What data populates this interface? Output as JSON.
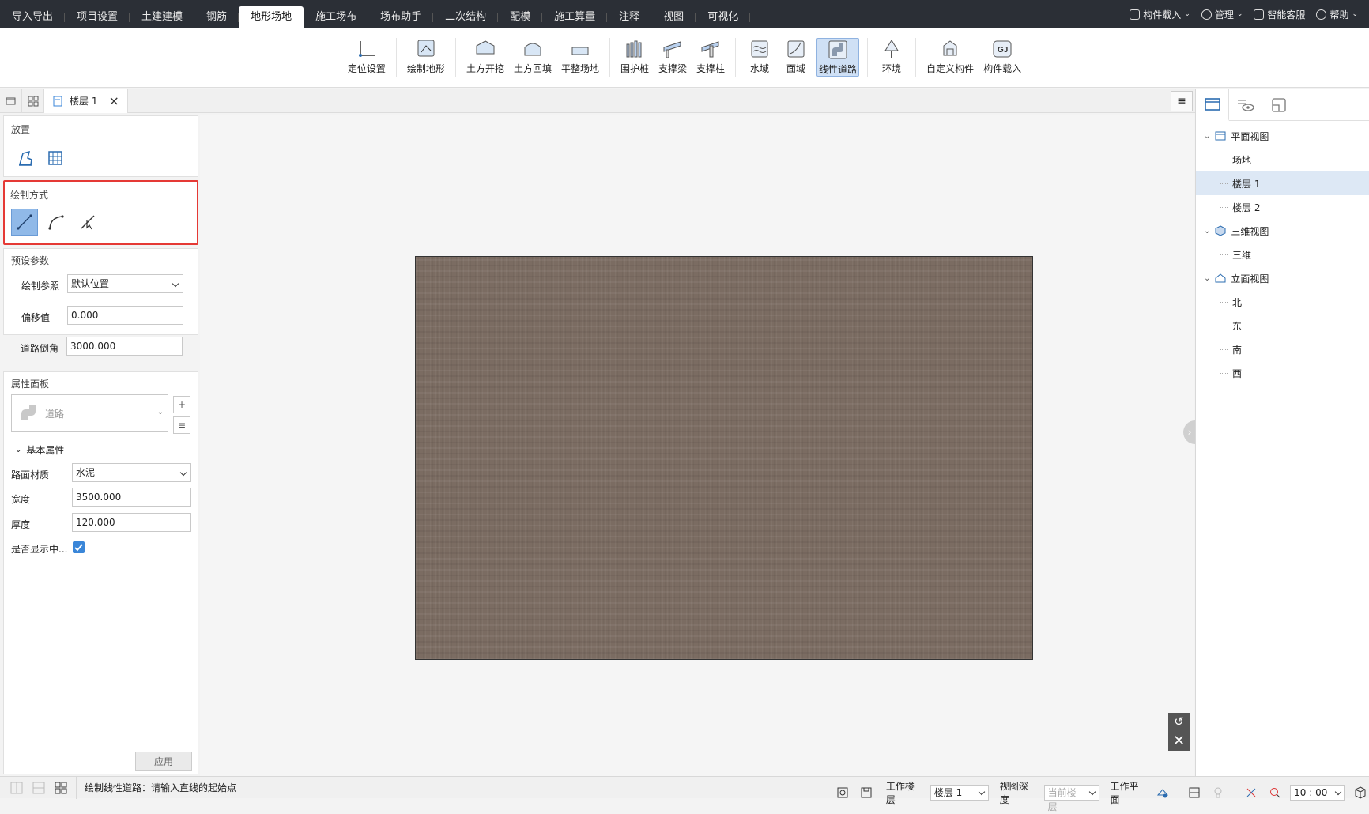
{
  "menubar": {
    "tabs": [
      "导入导出",
      "项目设置",
      "土建建模",
      "钢筋",
      "地形场地",
      "施工场布",
      "场布助手",
      "二次结构",
      "配模",
      "施工算量",
      "注释",
      "视图",
      "可视化"
    ],
    "active_tab": "地形场地",
    "right": {
      "load": "构件载入",
      "manage": "管理",
      "service": "智能客服",
      "help": "帮助"
    }
  },
  "ribbon": {
    "groups": [
      [
        {
          "label": "定位设置",
          "icon": "axis-icon"
        }
      ],
      [
        {
          "label": "绘制地形",
          "icon": "terrain-icon"
        }
      ],
      [
        {
          "label": "土方开挖",
          "icon": "excavate-icon"
        },
        {
          "label": "土方回填",
          "icon": "backfill-icon"
        },
        {
          "label": "平整场地",
          "icon": "level-icon"
        }
      ],
      [
        {
          "label": "围护桩",
          "icon": "pile-icon"
        },
        {
          "label": "支撑梁",
          "icon": "beam-icon"
        },
        {
          "label": "支撑柱",
          "icon": "column-icon"
        }
      ],
      [
        {
          "label": "水域",
          "icon": "water-icon"
        },
        {
          "label": "面域",
          "icon": "area-icon"
        },
        {
          "label": "线性道路",
          "icon": "road-icon",
          "active": true
        }
      ],
      [
        {
          "label": "环境",
          "icon": "tree-icon"
        }
      ],
      [
        {
          "label": "自定义构件",
          "icon": "custom-icon"
        },
        {
          "label": "构件载入",
          "icon": "gj-icon"
        }
      ]
    ]
  },
  "viewtabs": {
    "floor_tab": "楼层 1"
  },
  "leftpanel": {
    "place_title": "放置",
    "draw_title": "绘制方式",
    "preset_title": "预设参数",
    "preset": {
      "ref_label": "绘制参照",
      "ref_value": "默认位置",
      "offset_label": "偏移值",
      "offset_value": "0.000",
      "chamfer_label": "道路倒角",
      "chamfer_value": "3000.000"
    },
    "prop_title": "属性面板",
    "prop_type": "道路",
    "basic_title": "基本属性",
    "basic": {
      "material_label": "路面材质",
      "material_value": "水泥",
      "width_label": "宽度",
      "width_value": "3500.000",
      "thickness_label": "厚度",
      "thickness_value": "120.000",
      "center_label": "是否显示中...",
      "center_checked": true
    },
    "apply": "应用"
  },
  "rightpanel": {
    "tree": [
      {
        "label": "平面视图",
        "level": 0,
        "icon": "plan-view-icon"
      },
      {
        "label": "场地",
        "level": 1
      },
      {
        "label": "楼层 1",
        "level": 1,
        "selected": true
      },
      {
        "label": "楼层 2",
        "level": 1
      },
      {
        "label": "三维视图",
        "level": 0,
        "icon": "cube-icon"
      },
      {
        "label": "三维",
        "level": 1
      },
      {
        "label": "立面视图",
        "level": 0,
        "icon": "elevation-icon"
      },
      {
        "label": "北",
        "level": 1
      },
      {
        "label": "东",
        "level": 1
      },
      {
        "label": "南",
        "level": 1
      },
      {
        "label": "西",
        "level": 1
      }
    ]
  },
  "statusbar": {
    "message": "绘制线性道路：请输入直线的起始点",
    "work_floor_label": "工作楼层",
    "work_floor_value": "楼层 1",
    "view_depth_label": "视图深度",
    "view_depth_value": "当前楼层",
    "work_plane_label": "工作平面",
    "time_value": "10 : 00"
  },
  "colors": {
    "accent": "#3a86d8",
    "highlight_border": "#e53935",
    "ground": "#7b6c62",
    "topbar": "#2b2f36"
  }
}
